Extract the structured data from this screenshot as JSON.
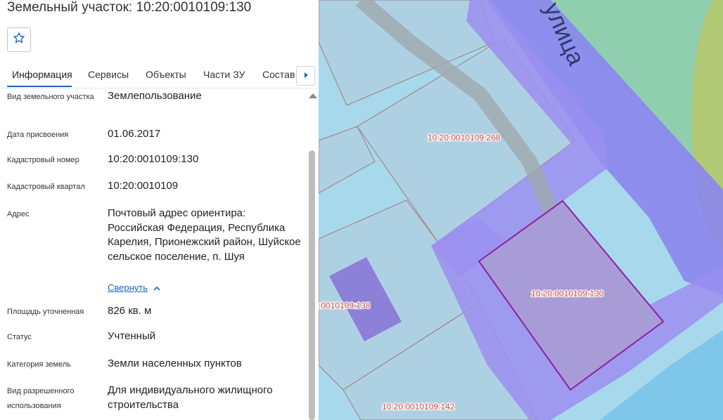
{
  "panel": {
    "title": "Земельный участок: 10:20:0010109:130",
    "favorite_icon": "star-outline-icon",
    "tabs": [
      "Информация",
      "Сервисы",
      "Объекты",
      "Части ЗУ",
      "Состав"
    ],
    "active_tab": "Информация",
    "tabs_next_icon": "caret-right-icon",
    "accent_color": "#1e63c4",
    "fields": [
      {
        "label": "Вид земельного участка",
        "value": "Землепользование"
      },
      {
        "label": "Дата присвоения",
        "value": "01.06.2017"
      },
      {
        "label": "Кадастровый номер",
        "value": "10:20:0010109:130"
      },
      {
        "label": "Кадастровый квартал",
        "value": "10:20:0010109"
      },
      {
        "label": "Адрес",
        "value": "Почтовый адрес ориентира: Российская Федерация, Республика Карелия, Прионежский район, Шуйское сельское поселение, п. Шуя"
      },
      {
        "label": "Площадь уточненная",
        "value": "826 кв. м"
      },
      {
        "label": "Статус",
        "value": "Учтенный"
      },
      {
        "label": "Категория земель",
        "value": "Земли населенных пунктов"
      },
      {
        "label": "Вид разрешенного использования",
        "value": "Для индивидуального жилищного строительства"
      }
    ],
    "collapse_link": "Свернуть",
    "collapse_icon": "chevron-up-icon"
  },
  "map": {
    "street_label": "улица",
    "parcel_labels": {
      "p268": "10:20:0010109:268",
      "p130": "10:20:0010109:130",
      "p138": ":0010109:138",
      "p142": "10:20:0010109:142"
    },
    "colors": {
      "water_background": "#a8d8ec",
      "parcel_fill": "#aed0e3",
      "road_purple": "#8a86ee",
      "selected_parcel": "#a89cd6",
      "selected_outline": "#8e1fa5",
      "green_zone": "#8fcfb0",
      "label_red": "#d14545"
    }
  }
}
